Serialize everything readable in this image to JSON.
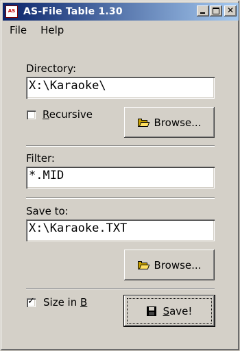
{
  "window": {
    "title": "AS-File Table 1.30",
    "icon_text": "AS"
  },
  "titlebar_buttons": {
    "minimize": "minimize",
    "maximize": "maximize",
    "close": "✕"
  },
  "menu": {
    "items": [
      "File",
      "Help"
    ]
  },
  "directory": {
    "label": "Directory:",
    "value": "X:\\Karaoke\\"
  },
  "recursive": {
    "label_first": "R",
    "label_rest": "ecursive",
    "checked": false
  },
  "browse1": {
    "label": "Browse..."
  },
  "filter": {
    "label": "Filter:",
    "value": "*.MID"
  },
  "save_to": {
    "label": "Save to:",
    "value": "X:\\Karaoke.TXT"
  },
  "browse2": {
    "label": "Browse..."
  },
  "size_in_b": {
    "label_main": "Size in ",
    "label_accel": "B",
    "checked": true
  },
  "save": {
    "label_accel": "S",
    "label_rest": "ave!"
  }
}
